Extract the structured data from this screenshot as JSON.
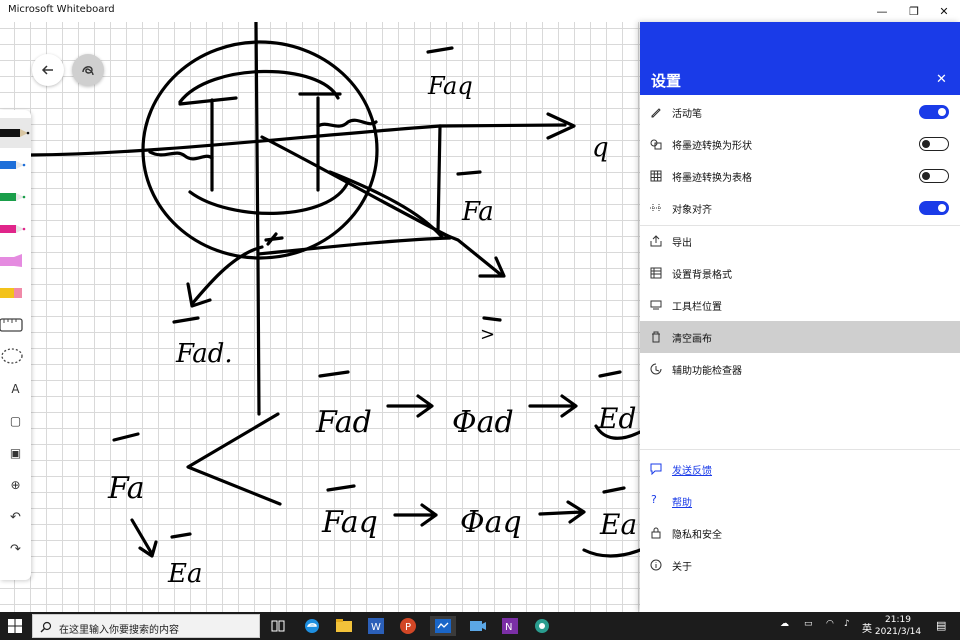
{
  "window": {
    "title": "Microsoft Whiteboard",
    "minimize_glyph": "—",
    "maximize_glyph": "❐",
    "close_glyph": "✕"
  },
  "canvas": {
    "back_icon": "back-arrow-icon",
    "ink_tools_icon": "ink-scribble-icon",
    "handwriting": {
      "fa_q": "Faq",
      "fa": "Fa",
      "fad": "Fad.",
      "q": "q",
      "fad2": "Fad",
      "phi_ad": "Φad",
      "e_d": "Ed",
      "fa_left": "Fa",
      "faq2": "Faq",
      "phi_aq": "Φaq",
      "e_aq": "Ea",
      "e_a": "Ea"
    }
  },
  "toolbar": {
    "tools": [
      {
        "name": "black-pen-tool",
        "color": "#111111"
      },
      {
        "name": "blue-pen-tool",
        "color": "#1e6fd9"
      },
      {
        "name": "green-pen-tool",
        "color": "#1a9e4a"
      },
      {
        "name": "pink-pen-tool",
        "color": "#e0258a"
      },
      {
        "name": "highlighter-tool",
        "color": "#e58be0"
      },
      {
        "name": "eraser-tool",
        "color": "#f3c21a"
      },
      {
        "name": "ruler-tool",
        "color": "#555555"
      },
      {
        "name": "lasso-tool",
        "color": "#555555"
      },
      {
        "name": "text-tool",
        "glyph": "A"
      },
      {
        "name": "sticky-note-tool",
        "glyph": "▢"
      },
      {
        "name": "image-tool",
        "glyph": "▣"
      },
      {
        "name": "add-tool",
        "glyph": "⊕"
      },
      {
        "name": "undo-tool",
        "glyph": "↶"
      },
      {
        "name": "redo-tool",
        "glyph": "↷"
      }
    ]
  },
  "settings": {
    "title": "设置",
    "close_glyph": "✕",
    "items": [
      {
        "label": "活动笔",
        "icon": "pen-icon",
        "toggle": "on"
      },
      {
        "label": "将墨迹转换为形状",
        "icon": "shapes-icon",
        "toggle": "off"
      },
      {
        "label": "将墨迹转换为表格",
        "icon": "table-icon",
        "toggle": "off"
      },
      {
        "label": "对象对齐",
        "icon": "snap-icon",
        "toggle": "on"
      },
      {
        "label": "导出",
        "icon": "export-icon"
      },
      {
        "label": "设置背景格式",
        "icon": "background-icon"
      },
      {
        "label": "工具栏位置",
        "icon": "toolbar-position-icon"
      },
      {
        "label": "清空画布",
        "icon": "trash-icon",
        "highlighted": true
      },
      {
        "label": "辅助功能检查器",
        "icon": "accessibility-icon"
      }
    ],
    "footer": [
      {
        "label": "发送反馈",
        "icon": "feedback-icon",
        "link": true
      },
      {
        "label": "帮助",
        "icon": "help-icon",
        "link": true
      },
      {
        "label": "隐私和安全",
        "icon": "lock-icon"
      },
      {
        "label": "关于",
        "icon": "info-icon"
      }
    ],
    "accent": "#1a3be8"
  },
  "taskbar": {
    "search_placeholder": "在这里输入你要搜索的内容",
    "tray_lang": "英",
    "time": "21:19",
    "date": "2021/3/14"
  }
}
